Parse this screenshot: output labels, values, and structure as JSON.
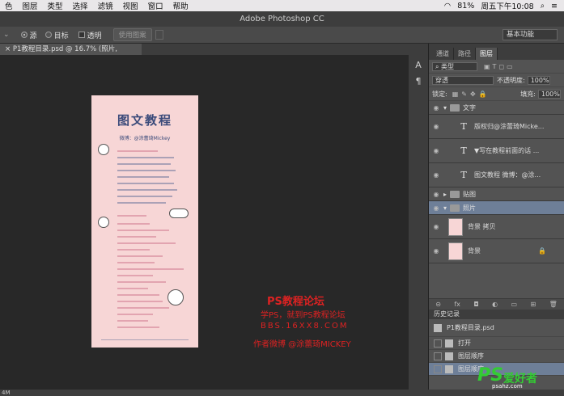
{
  "menubar": {
    "items": [
      "色",
      "图层",
      "类型",
      "选择",
      "滤镜",
      "视图",
      "窗口",
      "帮助"
    ],
    "battery": "81%",
    "clock": "周五下午10:08"
  },
  "app_title": "Adobe Photoshop CC",
  "options": {
    "source": "源",
    "target": "目标",
    "transparent": "透明",
    "use_pattern": "使用图案",
    "workspace": "基本功能"
  },
  "document_tab": "P1教程目录.psd @ 16.7% (照片, RGB/8)",
  "doc": {
    "title": "图文教程",
    "subtitle": "微博：@涂蕾琦Mickey"
  },
  "panel_tabs": [
    "通道",
    "路径",
    "图层"
  ],
  "layer_controls": {
    "filter": "类型",
    "blend": "穿透",
    "opacity_label": "不透明度:",
    "opacity": "100%",
    "lock_label": "锁定:",
    "fill_label": "填充:",
    "fill": "100%"
  },
  "layers": [
    {
      "kind": "group",
      "label": "文字"
    },
    {
      "kind": "text",
      "label": "版权归@涂蕾琦Micke..."
    },
    {
      "kind": "text",
      "label": "▼写在教程前面的话 ..."
    },
    {
      "kind": "text",
      "label": "图文教程 微博：@涂..."
    },
    {
      "kind": "group",
      "label": "贴图"
    },
    {
      "kind": "group",
      "label": "照片"
    },
    {
      "kind": "image",
      "label": "背景 拷贝"
    },
    {
      "kind": "image",
      "label": "背景"
    }
  ],
  "history": {
    "title": "历史记录",
    "snapshot": "P1教程目录.psd",
    "items": [
      "打开",
      "图层顺序",
      "图层顺序"
    ]
  },
  "status": "4M",
  "watermark": {
    "line1": "PS教程论坛",
    "line2": "学PS，就到PS教程论坛",
    "line3": "BBS.16XX8.COM",
    "line4": "作者微博 @涂蕾琦MICKEY"
  },
  "badge": {
    "ps": "PS",
    "name": "爱好者",
    "url": "psahz.com"
  }
}
